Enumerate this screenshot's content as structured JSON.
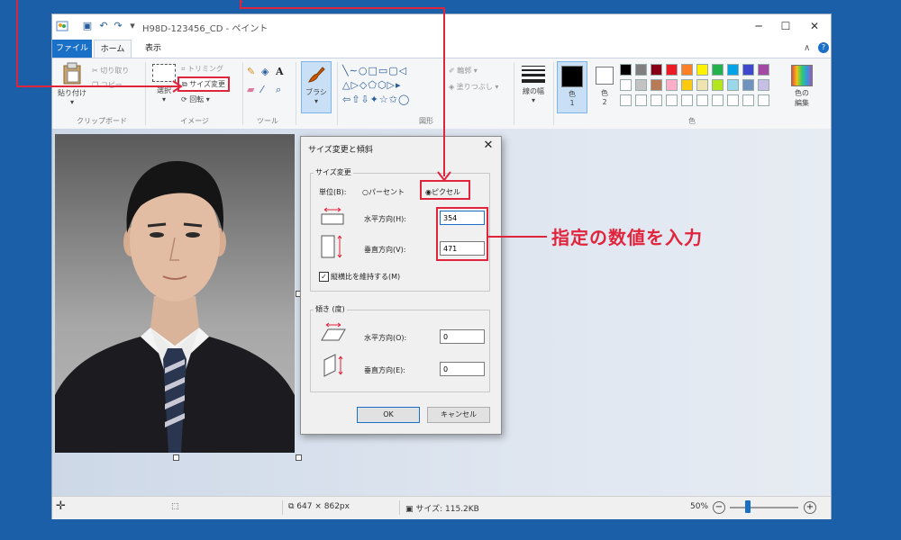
{
  "window": {
    "title": "H98D-123456_CD - ペイント",
    "minimize": "─",
    "maximize": "☐",
    "close": "✕"
  },
  "quick_access": {
    "save": "▣",
    "undo": "↶",
    "redo": "↷",
    "more": "▾"
  },
  "tabs": [
    {
      "label": "ファイル"
    },
    {
      "label": "ホーム"
    },
    {
      "label": "表示"
    }
  ],
  "ribbon": {
    "clipboard": {
      "paste": "貼り付け",
      "cut": "切り取り",
      "copy": "コピー",
      "group": "クリップボード"
    },
    "image": {
      "select": "選択",
      "crop": "トリミング",
      "resize": "サイズ変更",
      "rotate": "回転",
      "group": "イメージ"
    },
    "tools": {
      "group": "ツール",
      "text_icon": "A"
    },
    "brush": {
      "label": "ブラシ"
    },
    "shapes": {
      "outline": "輪郭",
      "fill": "塗りつぶし",
      "group": "図形"
    },
    "size": {
      "label": "線の幅"
    },
    "colors": {
      "color1": "色\n1",
      "color1_label": "色",
      "color1_num": "1",
      "color2_label": "色",
      "color2_num": "2",
      "edit": "色の\n編集",
      "edit_label_1": "色の",
      "edit_label_2": "編集",
      "group": "色",
      "palette_row1": [
        "#000000",
        "#7f7f7f",
        "#880015",
        "#ed1c24",
        "#ff7f27",
        "#fff200",
        "#22b14c",
        "#00a2e8",
        "#3f48cc",
        "#a349a4"
      ],
      "palette_row2": [
        "#ffffff",
        "#c3c3c3",
        "#b97a57",
        "#ffaec9",
        "#ffc90e",
        "#efe4b0",
        "#b5e61d",
        "#99d9ea",
        "#7092be",
        "#c8bfe7"
      ]
    }
  },
  "dialog": {
    "title": "サイズ変更と傾斜",
    "close": "✕",
    "resize_legend": "サイズ変更",
    "unit_label": "単位(B):",
    "percent": "パーセント",
    "pixels": "ピクセル",
    "horizontal_label": "水平方向(H):",
    "horizontal_value": "354",
    "vertical_label": "垂直方向(V):",
    "vertical_value": "471",
    "keep_ratio": "縦横比を維持する(M)",
    "skew_legend": "傾き (度)",
    "skew_h_label": "水平方向(O):",
    "skew_h_value": "0",
    "skew_v_label": "垂直方向(E):",
    "skew_v_value": "0",
    "ok": "OK",
    "cancel": "キャンセル"
  },
  "status": {
    "dimensions": "647 × 862px",
    "size": "サイズ: 115.2KB",
    "zoom": "50%"
  },
  "annotation": {
    "text": "指定の数値を入力"
  },
  "colors": {
    "accent": "#1a70c7",
    "annotation": "#e0243c",
    "background": "#1a5fa8"
  }
}
